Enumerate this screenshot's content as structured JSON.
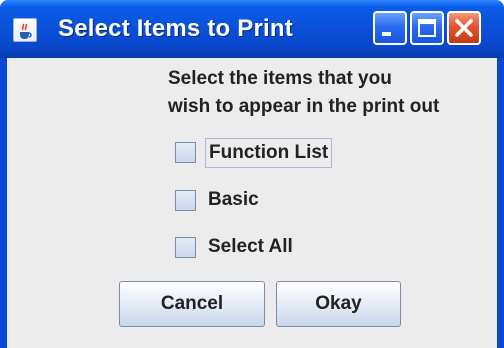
{
  "window": {
    "title": "Select Items to Print",
    "app_icon": "java-cup-icon",
    "controls": [
      "minimize-icon",
      "maximize-icon",
      "close-icon"
    ]
  },
  "message": {
    "line1": "Select the items that you",
    "line2": "wish to appear in the print out"
  },
  "checkboxes": [
    {
      "label": "Function List",
      "checked": false,
      "focused": true
    },
    {
      "label": "Basic",
      "checked": false,
      "focused": false
    },
    {
      "label": "Select All",
      "checked": false,
      "focused": false
    }
  ],
  "buttons": {
    "cancel_label": "Cancel",
    "okay_label": "Okay"
  },
  "colors": {
    "titlebar": "#0a4fd6",
    "close_button": "#e2552e",
    "client_background": "#ececec"
  }
}
